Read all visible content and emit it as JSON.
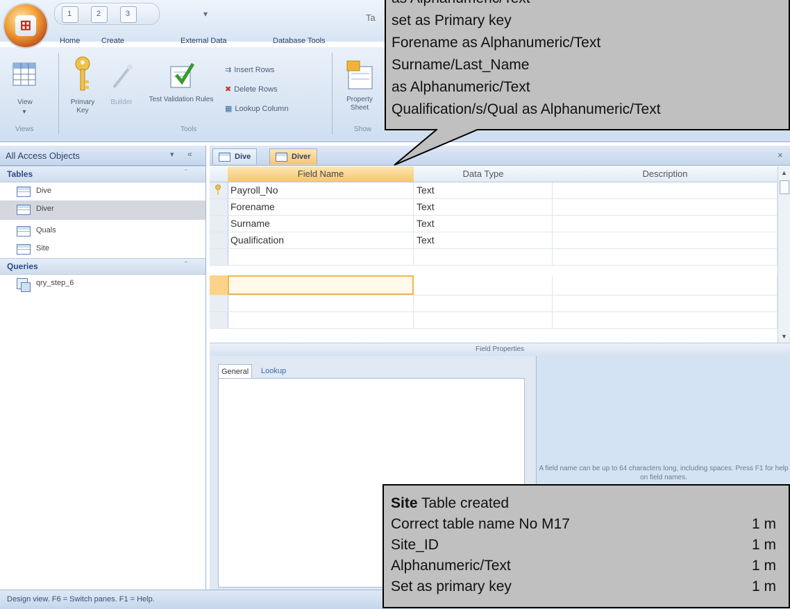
{
  "ribbon": {
    "title_fragment": "Ta",
    "qat_keys": [
      "1",
      "2",
      "3"
    ],
    "qat_dropdown": "▾",
    "tabs": [
      {
        "label": "Home",
        "key": "H"
      },
      {
        "label": "Create",
        "key": "C"
      },
      {
        "label": "External Data",
        "key": "X"
      },
      {
        "label": "Database Tools",
        "key": "A"
      }
    ],
    "buttons": {
      "view": "View",
      "primary_key": "Primary Key",
      "builder": "Builder",
      "test_validation": "Test Validation Rules",
      "insert_rows": "Insert Rows",
      "delete_rows": "Delete Rows",
      "lookup_column": "Lookup Column",
      "property_sheet": "Property Sheet"
    },
    "groups": {
      "views": "Views",
      "tools": "Tools",
      "show": "Show"
    }
  },
  "nav": {
    "title": "All Access Objects",
    "tables_header": "Tables",
    "tables": [
      "Dive",
      "Diver",
      "Quals",
      "Site"
    ],
    "queries_header": "Queries",
    "queries": [
      "qry_step_6"
    ]
  },
  "doc": {
    "tabs": [
      "Dive",
      "Diver"
    ],
    "close": "×",
    "columns": [
      "Field Name",
      "Data Type",
      "Description"
    ],
    "rows": [
      {
        "field": "Payroll_No",
        "type": "Text",
        "desc": ""
      },
      {
        "field": "Forename",
        "type": "Text",
        "desc": ""
      },
      {
        "field": "Surname",
        "type": "Text",
        "desc": ""
      },
      {
        "field": "Qualification",
        "type": "Text",
        "desc": ""
      }
    ],
    "field_properties": "Field Properties",
    "fp_tabs": [
      "General",
      "Lookup"
    ],
    "help_text": "A field name can be up to 64 characters long, including spaces. Press F1 for help on field names."
  },
  "status": "Design view.  F6 = Switch panes.  F1 = Help.",
  "callout_top": [
    "as Alphanumeric/Text",
    "set as Primary key",
    "Forename as Alphanumeric/Text",
    "Surname/Last_Name",
    "as Alphanumeric/Text",
    "Qualification/s/Qual as Alphanumeric/Text"
  ],
  "callout_bottom": {
    "title_bold": "Site",
    "title_rest": " Table created",
    "lines": [
      {
        "text": "Correct table name No M17",
        "mark": "1 m"
      },
      {
        "text": "Site_ID",
        "mark": "1 m"
      },
      {
        "text": "Alphanumeric/Text",
        "mark": "1 m"
      },
      {
        "text": "Set as primary key",
        "mark": "1 m"
      }
    ]
  },
  "colors": {
    "accent": "#f8c572",
    "ribbon": "#d7e4f3",
    "callout": "#c0c0c0"
  }
}
